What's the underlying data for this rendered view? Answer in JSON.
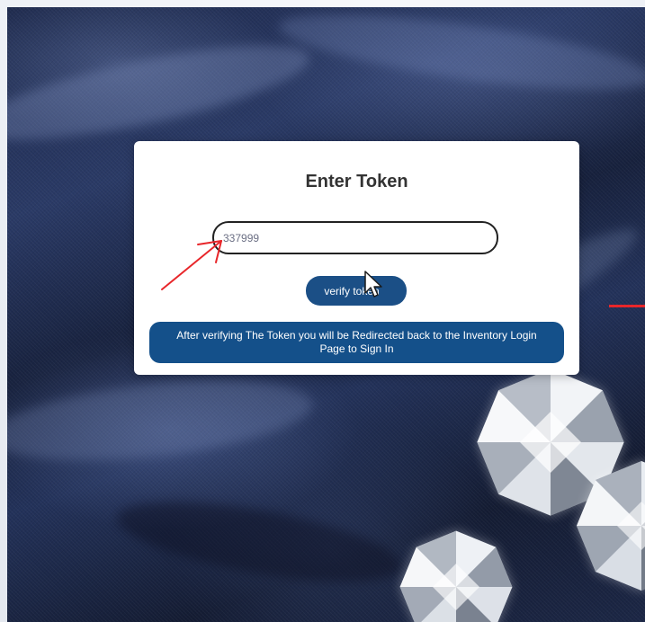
{
  "card": {
    "title": "Enter Token",
    "token_value": "337999",
    "verify_label": "verify token",
    "info_text": "After verifying The Token you will be Redirected back to the Inventory Login Page to Sign In"
  },
  "colors": {
    "button_bg": "#1b4f86",
    "banner_bg": "#14508a",
    "annotation": "#e8262a"
  },
  "icons": {
    "cursor": "mouse-pointer-icon",
    "annotation_arrow": "red-arrow-icon"
  }
}
